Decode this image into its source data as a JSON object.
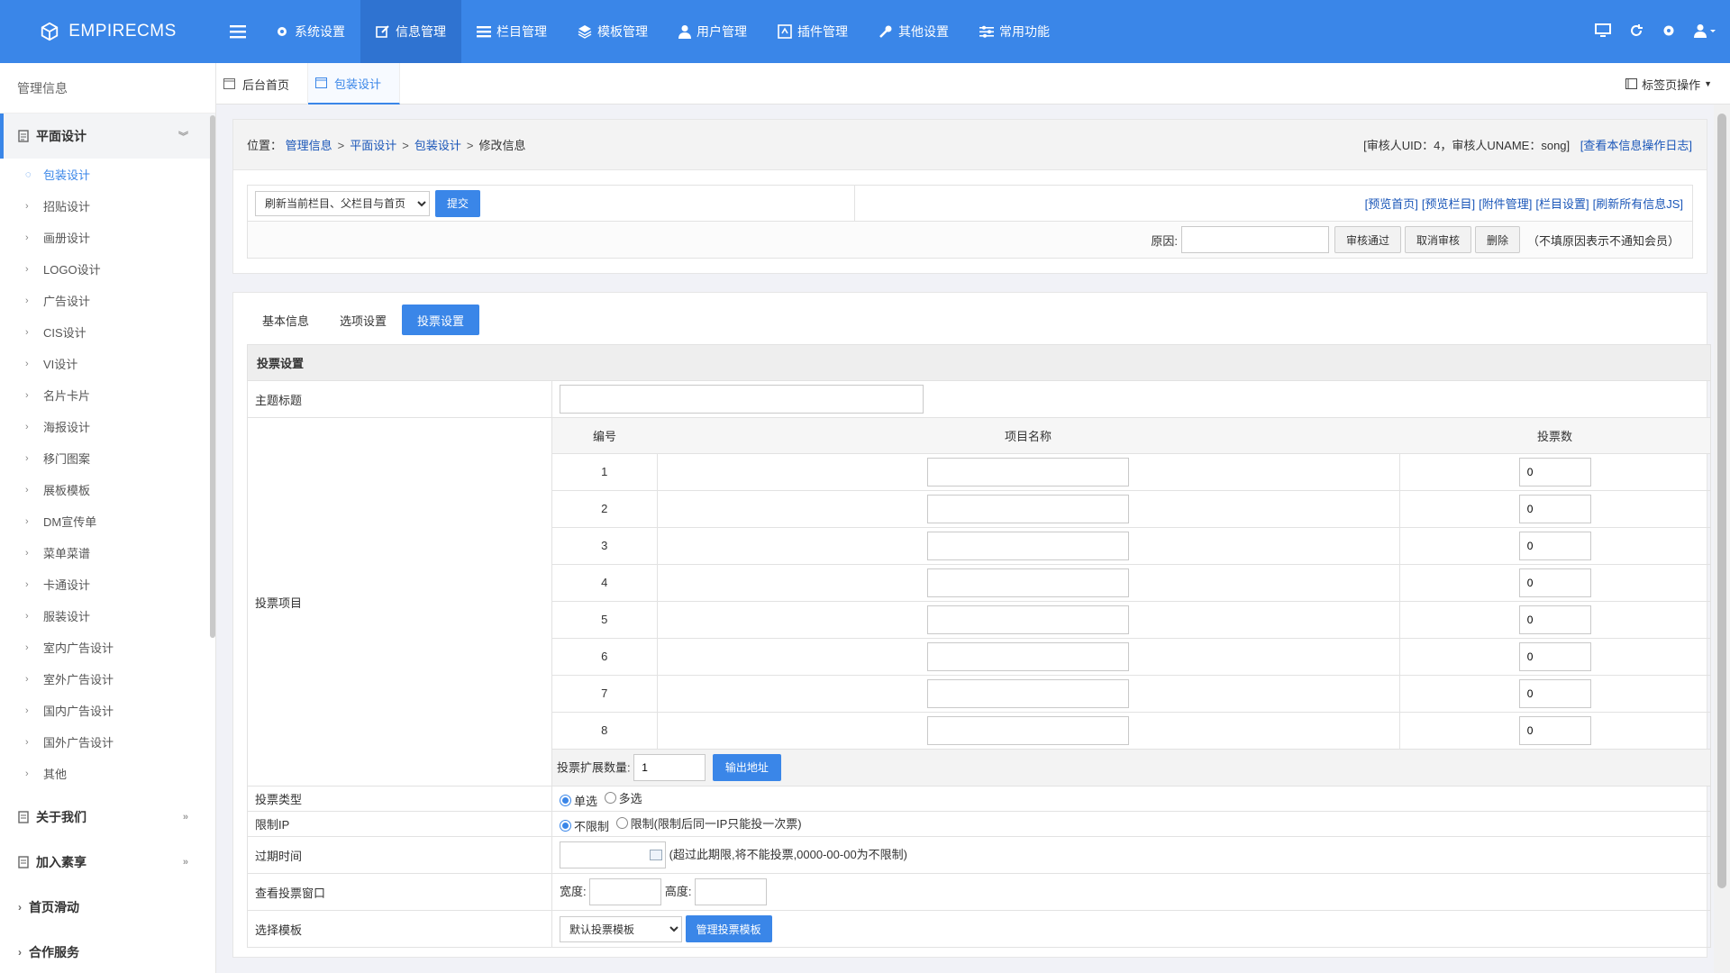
{
  "app": {
    "logo": "EMPIRECMS"
  },
  "topnav": [
    {
      "label": "系统设置",
      "icon": "gear-icon"
    },
    {
      "label": "信息管理",
      "icon": "edit-icon",
      "active": true
    },
    {
      "label": "栏目管理",
      "icon": "list-icon"
    },
    {
      "label": "模板管理",
      "icon": "layers-icon"
    },
    {
      "label": "用户管理",
      "icon": "user-icon"
    },
    {
      "label": "插件管理",
      "icon": "plugin-icon"
    },
    {
      "label": "其他设置",
      "icon": "wrench-icon"
    },
    {
      "label": "常用功能",
      "icon": "sliders-icon"
    }
  ],
  "sidebar": {
    "header": "管理信息",
    "group_open": "平面设计",
    "items": [
      "包装设计",
      "招贴设计",
      "画册设计",
      "LOGO设计",
      "广告设计",
      "CIS设计",
      "VI设计",
      "名片卡片",
      "海报设计",
      "移门图案",
      "展板模板",
      "DM宣传单",
      "菜单菜谱",
      "卡通设计",
      "服装设计",
      "室内广告设计",
      "室外广告设计",
      "国内广告设计",
      "国外广告设计",
      "其他"
    ],
    "groups_after": [
      "关于我们",
      "加入素享",
      "首页滑动",
      "合作服务"
    ]
  },
  "tabs": {
    "home": "后台首页",
    "current": "包装设计",
    "ops": "标签页操作"
  },
  "breadcrumb": {
    "prefix": "位置：",
    "links": [
      "管理信息",
      "平面设计",
      "包装设计"
    ],
    "current": "修改信息",
    "sep": ">",
    "checker": "[审核人UID：4，审核人UNAME：song]",
    "log_link": "[查看本信息操作日志]"
  },
  "actions": {
    "refresh_select": "刷新当前栏目、父栏目与首页",
    "submit": "提交",
    "links": [
      "[预览首页]",
      "[预览栏目]",
      "[附件管理]",
      "[栏目设置]",
      "[刷新所有信息JS]"
    ],
    "reason_label": "原因:",
    "approve": "审核通过",
    "cancel_approve": "取消审核",
    "delete": "删除",
    "note": "（不填原因表示不通知会员）"
  },
  "subtabs": [
    "基本信息",
    "选项设置",
    "投票设置"
  ],
  "vote": {
    "section": "投票设置",
    "topic_label": "主题标题",
    "items_label": "投票项目",
    "col_no": "编号",
    "col_name": "项目名称",
    "col_votes": "投票数",
    "rows": [
      {
        "no": "1",
        "votes": "0"
      },
      {
        "no": "2",
        "votes": "0"
      },
      {
        "no": "3",
        "votes": "0"
      },
      {
        "no": "4",
        "votes": "0"
      },
      {
        "no": "5",
        "votes": "0"
      },
      {
        "no": "6",
        "votes": "0"
      },
      {
        "no": "7",
        "votes": "0"
      },
      {
        "no": "8",
        "votes": "0"
      }
    ],
    "ext_label": "投票扩展数量:",
    "ext_value": "1",
    "ext_button": "输出地址",
    "type_label": "投票类型",
    "type_single": "单选",
    "type_multi": "多选",
    "ip_label": "限制IP",
    "ip_none": "不限制",
    "ip_limit": "限制(限制后同一IP只能投一次票)",
    "expire_label": "过期时间",
    "expire_note": "(超过此期限,将不能投票,0000-00-00为不限制)",
    "window_label": "查看投票窗口",
    "width_label": "宽度:",
    "height_label": "高度:",
    "template_label": "选择模板",
    "template_value": "默认投票模板",
    "template_button": "管理投票模板"
  },
  "colors": {
    "accent": "#3a86e8",
    "nav_active": "#2f73d1"
  }
}
